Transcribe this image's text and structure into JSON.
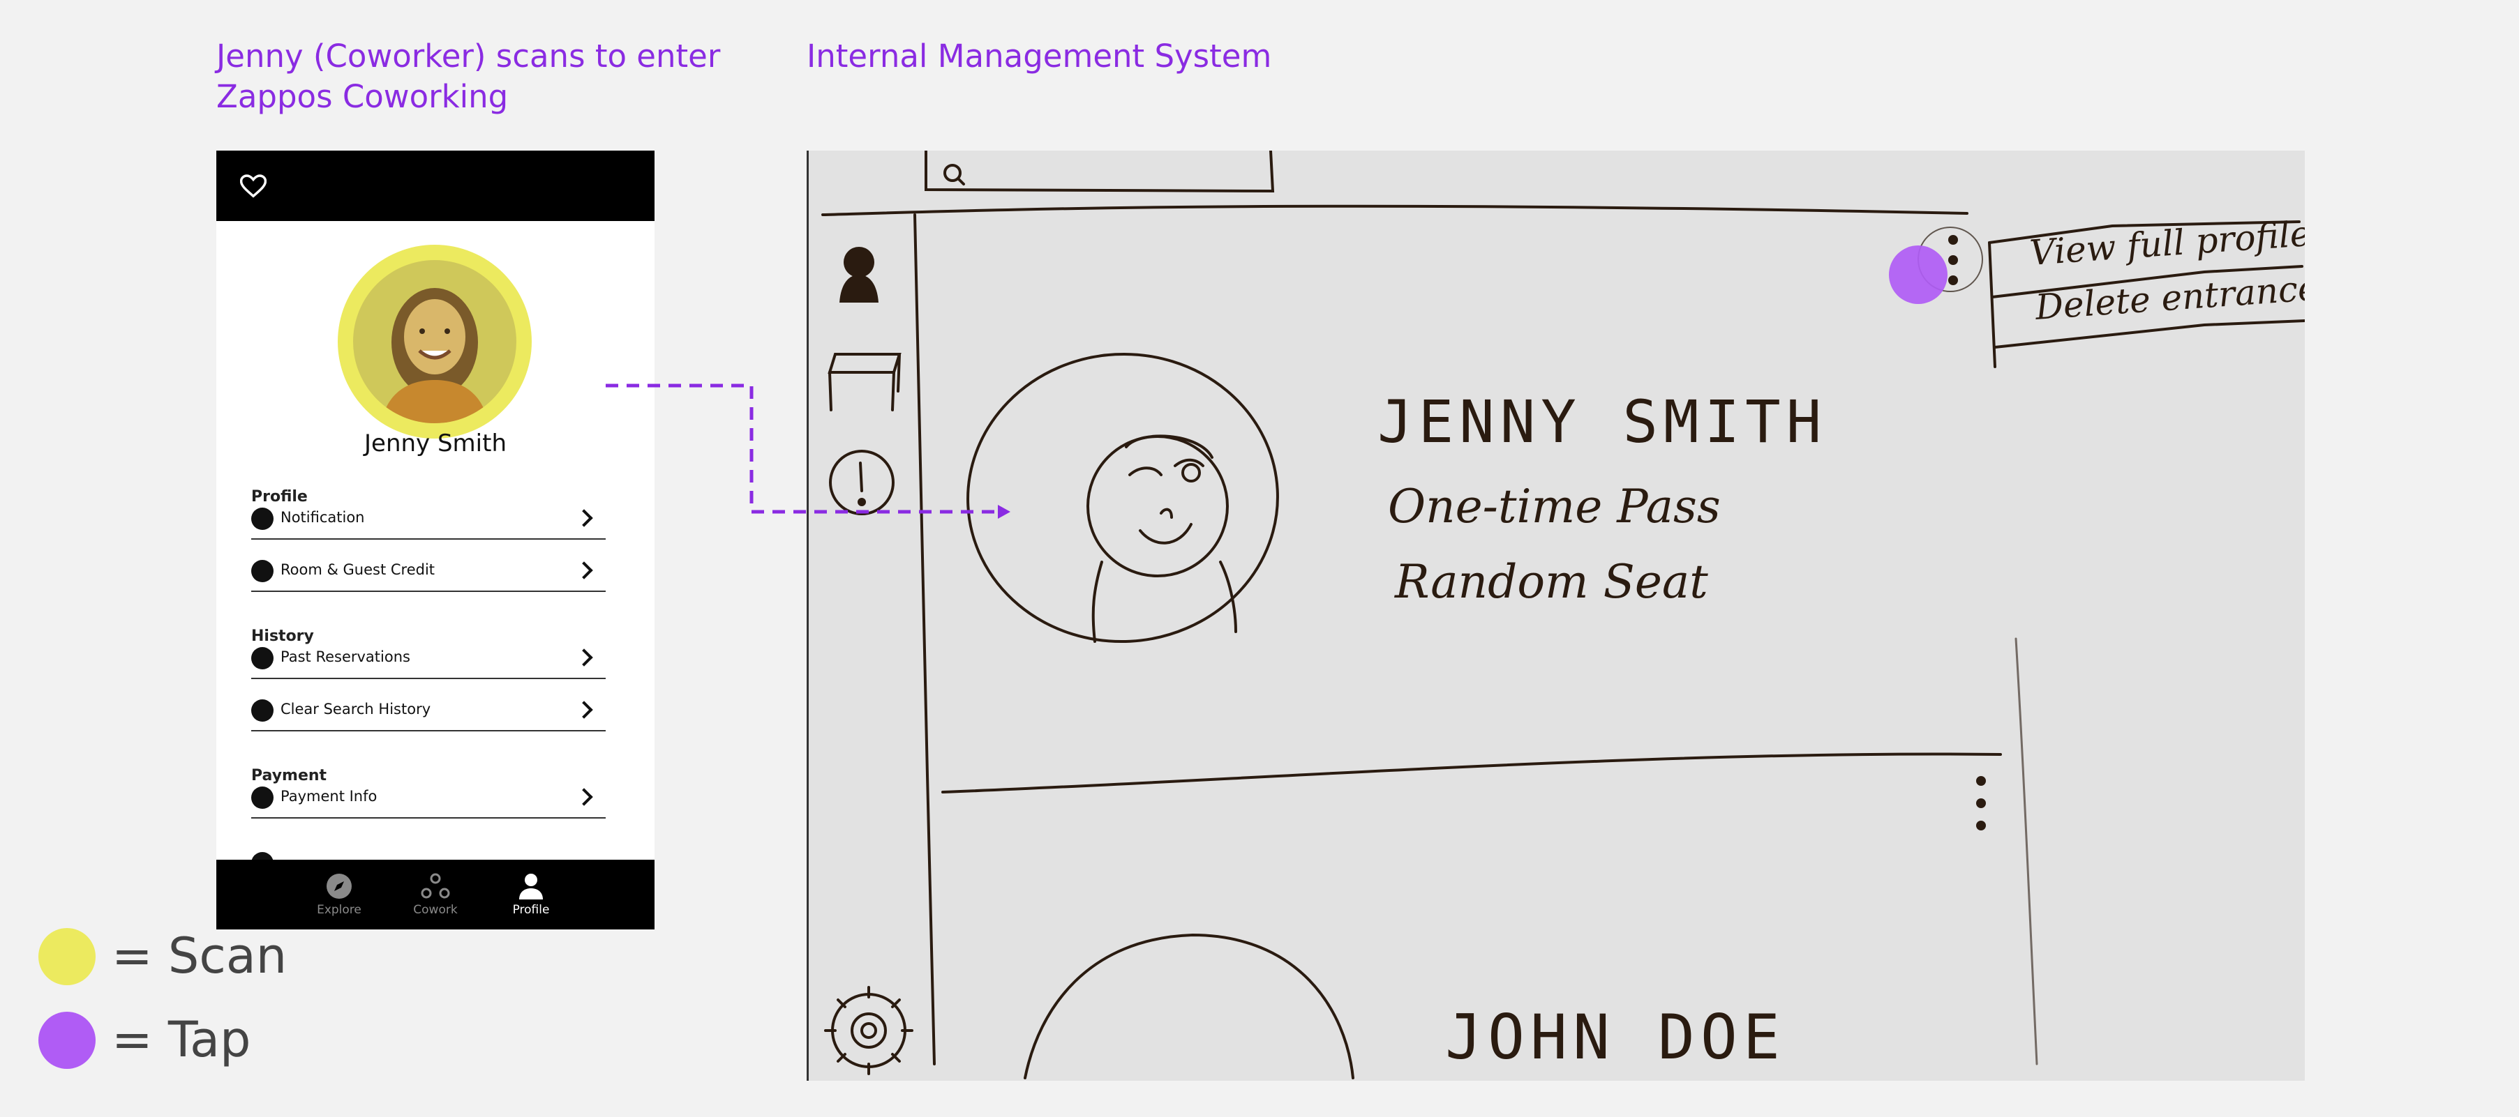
{
  "headings": {
    "left": "Jenny (Coworker) scans to enter Zappos Coworking",
    "right": "Internal Management System"
  },
  "phone": {
    "user_name": "Jenny Smith",
    "sections": {
      "profile": "Profile",
      "history": "History",
      "payment": "Payment"
    },
    "rows": {
      "notification": "Notification",
      "room_guest_credit": "Room & Guest Credit",
      "past_reservations": "Past Reservations",
      "clear_search_history": "Clear Search History",
      "payment_info": "Payment Info"
    },
    "tabs": {
      "explore": "Explore",
      "cowork": "Cowork",
      "profile": "Profile"
    },
    "icons": [
      "heart-icon",
      "bell-icon",
      "smiley-icon",
      "clock-icon",
      "no-entry-icon",
      "wallet-icon",
      "compass-icon",
      "cowork-icon",
      "person-icon"
    ]
  },
  "legend": {
    "scan_label": "= Scan",
    "tap_label": "= Tap"
  },
  "sketch": {
    "menu": {
      "view_full_profile": "View full profile",
      "delete_entrance": "Delete entrance"
    },
    "card1": {
      "name": "JENNY SMITH",
      "pass": "One-time Pass",
      "seat": "Random Seat"
    },
    "card2": {
      "name": "JOHN DOE"
    },
    "icons": [
      "search-icon",
      "user-icon",
      "desk-icon",
      "alert-icon",
      "gear-icon",
      "more-vertical-icon"
    ]
  },
  "colors": {
    "accent": "#8a2be2",
    "scan": "#ecea5f",
    "tap": "#b05cf5",
    "background": "#f2f2f2"
  }
}
